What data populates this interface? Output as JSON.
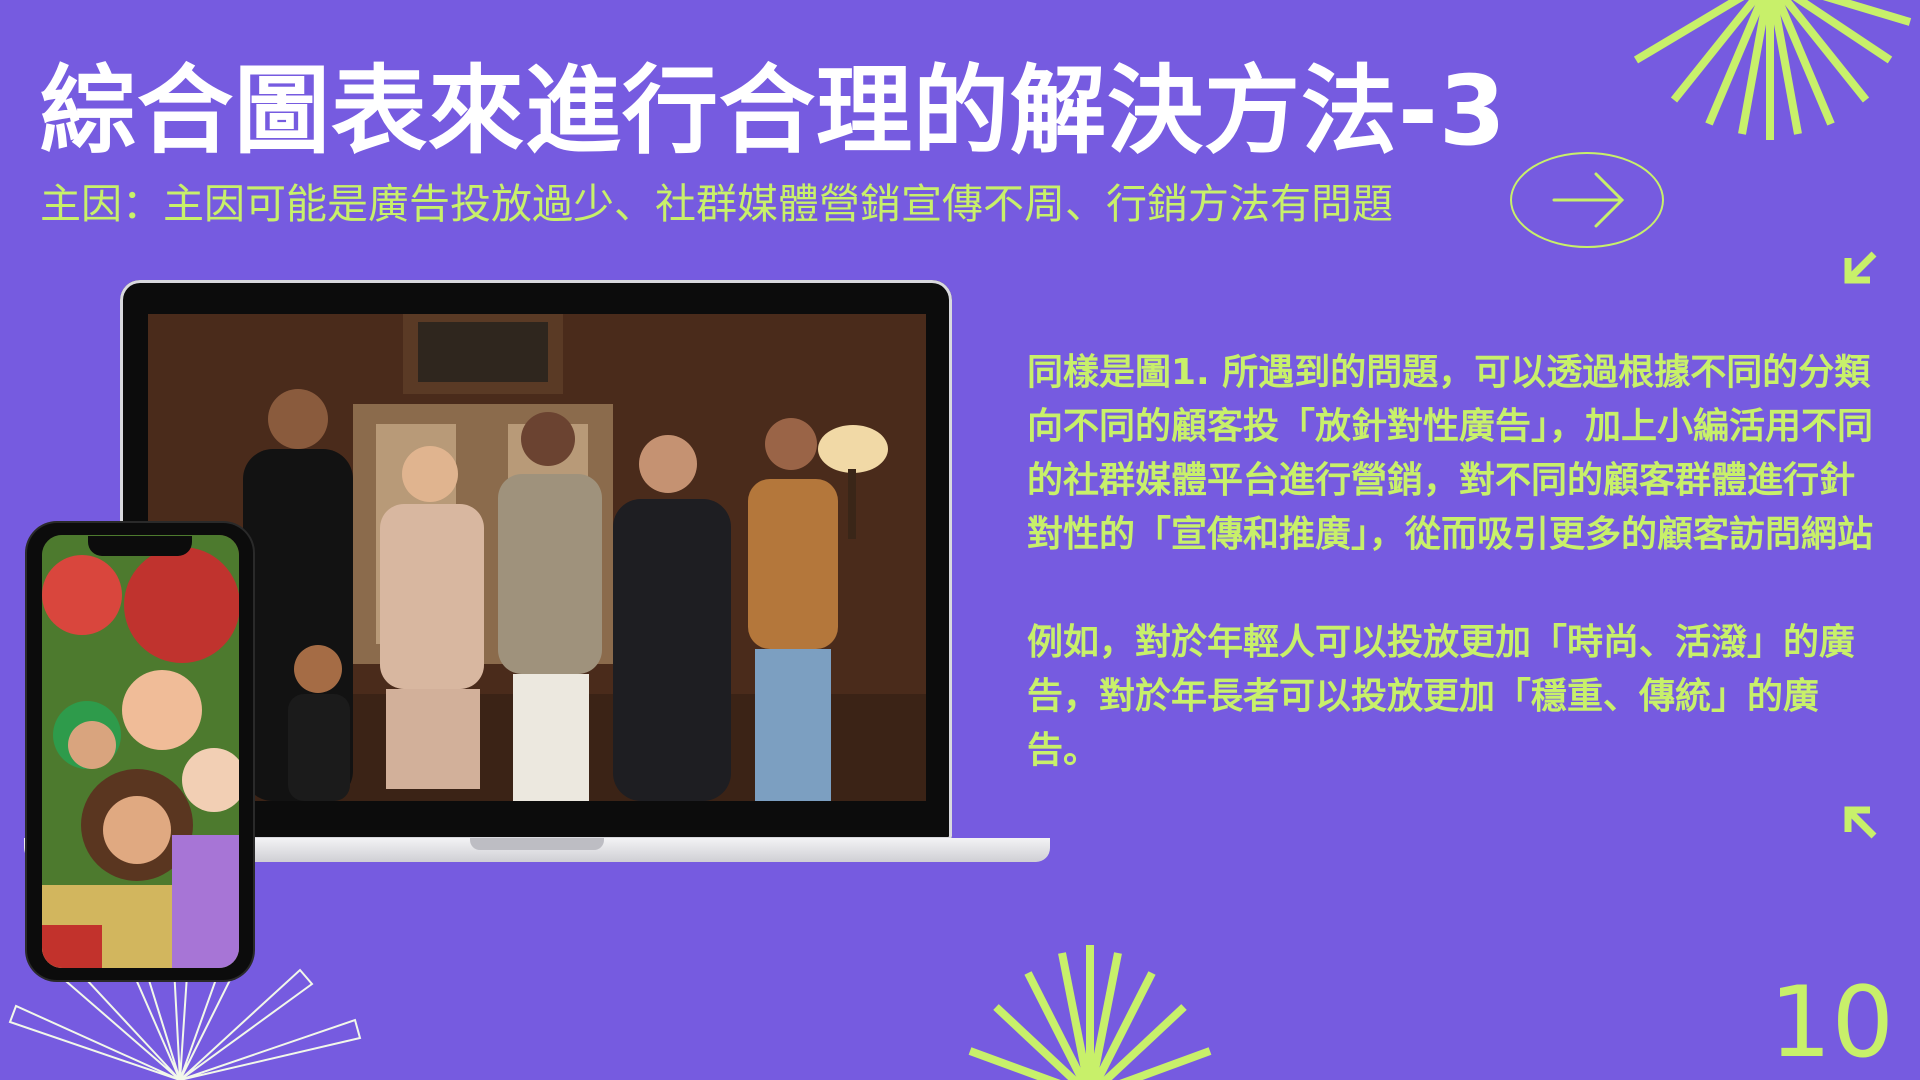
{
  "slide": {
    "title": "綜合圖表來進行合理的解決方法-3",
    "subtitle": "主因：主因可能是廣告投放過少、社群媒體營銷宣傳不周、行銷方法有問題",
    "paragraphs": [
      "同樣是圖1. 所遇到的問題，可以透過根據不同的分類向不同的顧客投「放針對性廣告」，加上小編活用不同的社群媒體平台進行營銷，對不同的顧客群體進行針對性的「宣傳和推廣」，從而吸引更多的顧客訪問網站",
      "例如，對於年輕人可以投放更加「時尚、活潑」的廣告，對於年長者可以投放更加「穩重、傳統」的廣告。"
    ],
    "page_number": "10"
  },
  "colors": {
    "background": "#765be0",
    "accent": "#c8f06a",
    "title": "#ffffff",
    "burst_light": "#f2f8ea"
  },
  "icons": {
    "next_button": "arrow-right-icon",
    "top_corner": "arrow-down-left-icon",
    "bottom_corner": "arrow-up-left-icon"
  }
}
